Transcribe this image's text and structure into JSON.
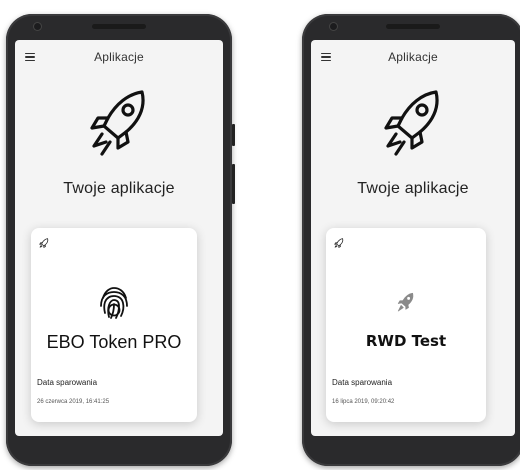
{
  "colors": {
    "screen_bg": "#f4f4f4",
    "frame": "#2a2a2c",
    "card_bg": "#ffffff",
    "grey_rocket": "#8a8a8a"
  },
  "icons": {
    "menu": "menu-icon",
    "hero": "rocket-icon",
    "card_corner": "small-rocket-icon",
    "fingerprint": "fingerprint-icon"
  },
  "phones": [
    {
      "header": {
        "title": "Aplikacje"
      },
      "section_title": "Twoje aplikacje",
      "card": {
        "name": "EBO Token PRO",
        "logo": "fingerprint-icon",
        "pair_label": "Data sparowania",
        "pair_date": "26 czerwca 2019, 16:41:25"
      }
    },
    {
      "header": {
        "title": "Aplikacje"
      },
      "section_title": "Twoje aplikacje",
      "card": {
        "name": "RWD Test",
        "logo": "rocket-icon",
        "pair_label": "Data sparowania",
        "pair_date": "16 lipca 2019, 09:20:42"
      }
    }
  ]
}
